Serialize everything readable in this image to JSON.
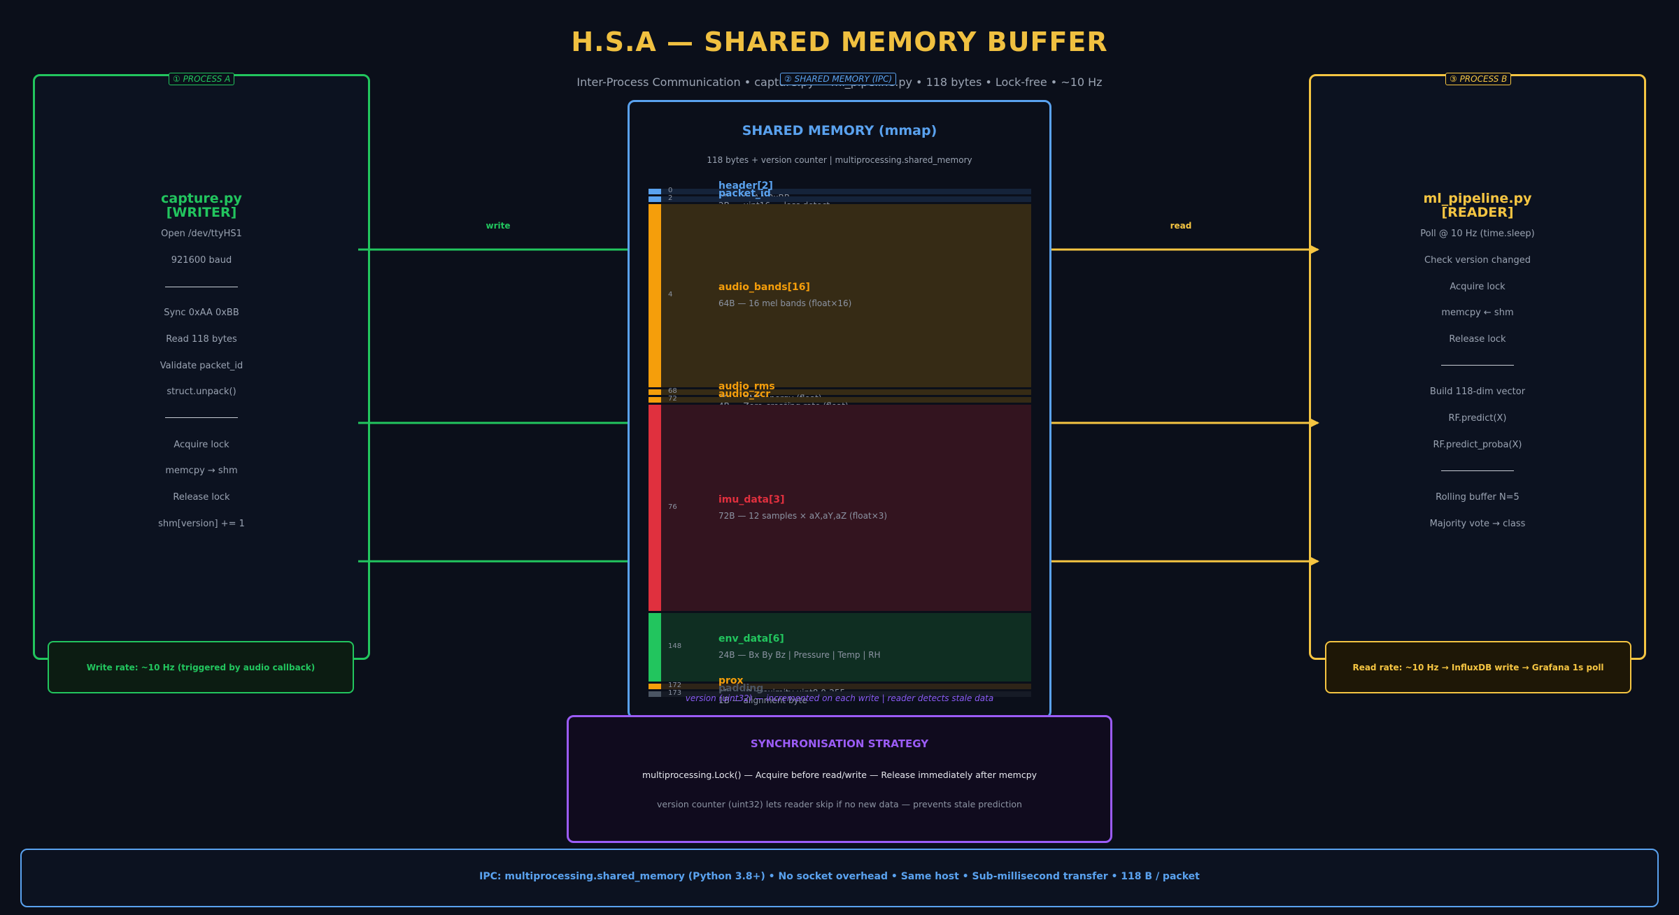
{
  "title": "H.S.A  —  SHARED MEMORY BUFFER",
  "subtitle": "Inter-Process Communication  •  capture.py  →  ml_pipeline.py  •  118 bytes  •  Lock-free  •  ~10 Hz",
  "colors": {
    "writer": "#22c55e",
    "reader": "#f5c542",
    "memory": "#5aa2ef",
    "sync": "#9b5cf6",
    "imu": "#e0303e",
    "audio": "#f59e0b"
  },
  "process_a": {
    "tag": "① PROCESS A",
    "title_line1": "capture.py",
    "title_line2": "[WRITER]",
    "steps_1": [
      "Open /dev/ttyHS1",
      "921600 baud"
    ],
    "steps_2": [
      "Sync 0xAA 0xBB",
      "Read 118 bytes",
      "Validate packet_id",
      "struct.unpack()"
    ],
    "steps_3": [
      "Acquire lock",
      "memcpy → shm",
      "Release lock",
      "shm[version] += 1"
    ],
    "rate": "Write rate: ~10 Hz  (triggered by audio callback)"
  },
  "process_b": {
    "tag": "③ PROCESS B",
    "title_line1": "ml_pipeline.py",
    "title_line2": "[READER]",
    "steps_1": [
      "Poll @ 10 Hz (time.sleep)",
      "Check version changed",
      "Acquire lock",
      "memcpy ← shm",
      "Release lock"
    ],
    "steps_2": [
      "Build 118-dim vector",
      "RF.predict(X)",
      "RF.predict_proba(X)"
    ],
    "steps_3": [
      "Rolling buffer N=5",
      "Majority vote → class"
    ],
    "rate": "Read rate: ~10 Hz  →  InfluxDB write  →  Grafana 1s poll"
  },
  "arrows": {
    "write_label": "write",
    "read_label": "read"
  },
  "memory": {
    "tag": "② SHARED MEMORY  (IPC)",
    "title": "SHARED MEMORY  (mmap)",
    "subtitle": "118 bytes  +  version counter  |  multiprocessing.shared_memory",
    "fields": [
      {
        "offset": "0",
        "name": "header[2]",
        "desc": "2B  —  0xAA 0xBB",
        "color": "#5aa2ef",
        "bg": "#15233a",
        "bytes": 2
      },
      {
        "offset": "2",
        "name": "packet_id",
        "desc": "2B  —  uint16 — loss detect",
        "color": "#5aa2ef",
        "bg": "#15233a",
        "bytes": 2
      },
      {
        "offset": "4",
        "name": "audio_bands[16]",
        "desc": "64B  —  16 mel bands  (float×16)",
        "color": "#f59e0b",
        "bg": "#362b15",
        "bytes": 64
      },
      {
        "offset": "68",
        "name": "audio_rms",
        "desc": "4B  —  RMS energy  (float)",
        "color": "#f59e0b",
        "bg": "#362b15",
        "bytes": 4
      },
      {
        "offset": "72",
        "name": "audio_zcr",
        "desc": "4B  —  Zero-crossing rate  (float)",
        "color": "#f59e0b",
        "bg": "#362b15",
        "bytes": 4
      },
      {
        "offset": "76",
        "name": "imu_data[3]",
        "desc": "72B  —  12 samples × aX,aY,aZ  (float×3)",
        "color": "#e0303e",
        "bg": "#33141f",
        "bytes": 72
      },
      {
        "offset": "148",
        "name": "env_data[6]",
        "desc": "24B  —  Bx By Bz | Pressure | Temp | RH",
        "color": "#22c55e",
        "bg": "#0f2e22",
        "bytes": 24
      },
      {
        "offset": "172",
        "name": "prox",
        "desc": "1B  —  IR proximity  uint8  0-255",
        "color": "#f59e0b",
        "bg": "#2e2418",
        "bytes": 1
      },
      {
        "offset": "173",
        "name": "padding",
        "desc": "1B  —  alignment byte",
        "color": "#4b5563",
        "bg": "#161b26",
        "bytes": 1
      }
    ],
    "version_note": "version (uint32)  —  incremented on each write  |  reader detects stale data"
  },
  "sync": {
    "title": "SYNCHRONISATION STRATEGY",
    "line1": "multiprocessing.Lock()   —   Acquire before read/write   —   Release immediately after memcpy",
    "line2": "version counter (uint32)  lets reader skip if no new data  —  prevents stale prediction"
  },
  "footer": "IPC: multiprocessing.shared_memory  (Python 3.8+)  •  No socket overhead  •  Same host  •  Sub-millisecond transfer  •  118 B / packet"
}
